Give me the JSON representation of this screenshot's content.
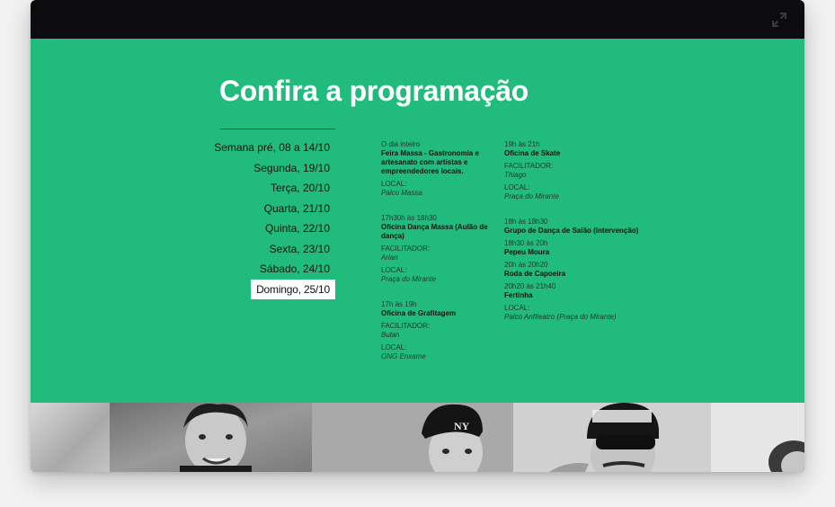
{
  "window": {
    "expand_icon": "expand-arrows-icon"
  },
  "page": {
    "title": "Confira a programação"
  },
  "colors": {
    "accent": "#21bb7d",
    "topbar": "#0c0c0e",
    "active_bg": "#ffffff"
  },
  "days": [
    {
      "label": "Semana pré, 08 a 14/10",
      "active": false
    },
    {
      "label": "Segunda, 19/10",
      "active": false
    },
    {
      "label": "Terça, 20/10",
      "active": false
    },
    {
      "label": "Quarta, 21/10",
      "active": false
    },
    {
      "label": "Quinta, 22/10",
      "active": false
    },
    {
      "label": "Sexta, 23/10",
      "active": false
    },
    {
      "label": "Sábado, 24/10",
      "active": false
    },
    {
      "label": "Domingo, 25/10",
      "active": true
    }
  ],
  "schedule": {
    "col1": [
      {
        "time": "O dia inteiro",
        "name": "Feira Massa - Gastronomia e artesanato com artistas e empreendedores locais.",
        "local_label": "LOCAL:",
        "local": "Palco Massa"
      },
      {
        "time": "17h30h às 18h30",
        "name": "Oficina Dança Massa (Aulão de dança)",
        "facilitador_label": "FACILITADOR:",
        "facilitador": "Arlan",
        "local_label": "LOCAL:",
        "local": "Praça do Mirante"
      },
      {
        "time": "17h às 19h",
        "name": "Oficina de Grafitagem",
        "facilitador_label": "FACILITADOR:",
        "facilitador": "Bulan",
        "local_label": "LOCAL:",
        "local": "ONG Enxame"
      }
    ],
    "col2": {
      "skate": {
        "time": "19h às 21h",
        "name": "Oficina de Skate",
        "facilitador_label": "FACILITADOR:",
        "facilitador": "Thiago",
        "local_label": "LOCAL:",
        "local": "Praça do Mirante"
      },
      "danca": {
        "time": "18h às 18h30",
        "name": "Grupo de Dança de Salão (intervenção)"
      },
      "pepeu": {
        "time": "18h30 às 20h",
        "name": "Pepeu Moura"
      },
      "capoeira": {
        "time": "20h às 20h20",
        "name": "Roda de Capoeira"
      },
      "fertinha": {
        "time": "20h20 às 21h40",
        "name": "Fertinha",
        "local_label": "LOCAL:",
        "local": "Palco Anfiteatro (Praça do Mirante)"
      }
    }
  }
}
